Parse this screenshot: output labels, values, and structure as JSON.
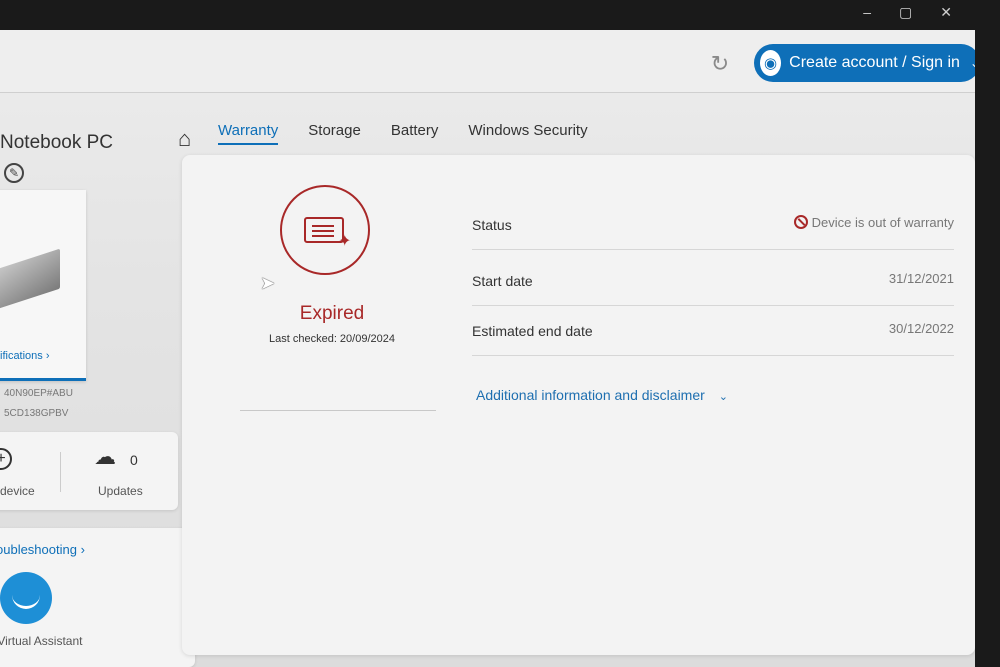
{
  "topbar": {
    "signin_label": "Create account / Sign in"
  },
  "device": {
    "name": "Notebook PC",
    "specs_link": "ifications ›",
    "product_number": "40N90EP#ABU",
    "serial_number": "5CD138GPBV"
  },
  "stats": {
    "add_device_label": "d device",
    "updates_count": "0",
    "updates_label": "Updates"
  },
  "support": {
    "troubleshooting_label": "oubleshooting ›",
    "assistant_label": "r Virtual Assistant"
  },
  "tabs": [
    {
      "label": "Warranty",
      "active": true
    },
    {
      "label": "Storage",
      "active": false
    },
    {
      "label": "Battery",
      "active": false
    },
    {
      "label": "Windows Security",
      "active": false
    }
  ],
  "warranty": {
    "status_title": "Expired",
    "last_checked": "Last checked: 20/09/2024",
    "rows": [
      {
        "label": "Status",
        "value": "Device is out of warranty"
      },
      {
        "label": "Start date",
        "value": "31/12/2021"
      },
      {
        "label": "Estimated end date",
        "value": "30/12/2022"
      }
    ],
    "disclaimer_link": "Additional information and disclaimer"
  },
  "colors": {
    "accent": "#0e6fb8",
    "expired": "#a82828"
  },
  "icons": [
    "refresh-icon",
    "user-icon",
    "chevron-down-icon",
    "edit-icon",
    "home-icon",
    "add-device-icon",
    "cloud-download-icon",
    "virtual-assistant-icon",
    "warranty-certificate-icon",
    "no-entry-icon"
  ]
}
